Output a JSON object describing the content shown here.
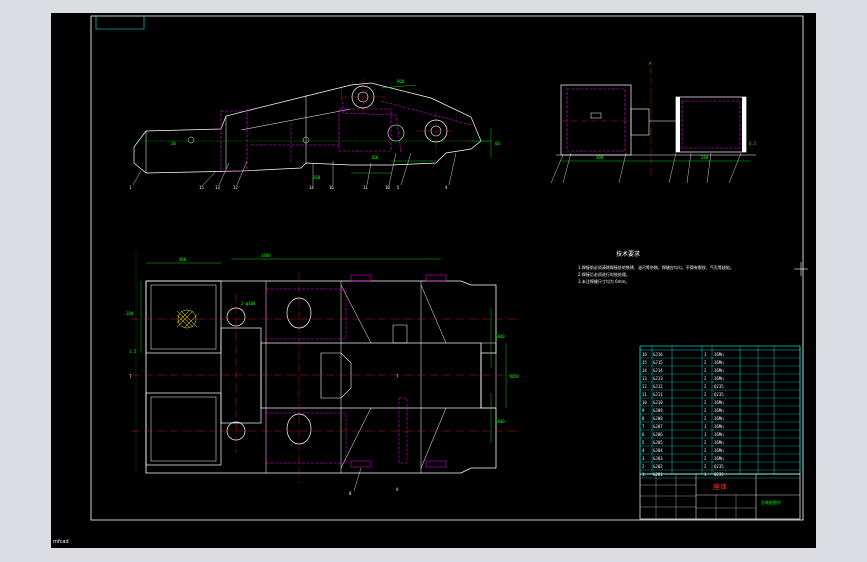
{
  "notes": {
    "title": "技术要求",
    "lines": [
      "1.焊接前必须清除焊接处的铁锈、油污等杂物，焊缝应均匀，不得有裂纹、气孔等缺陷。",
      "2.焊接后必须进行时效处理。",
      "3.未注焊缝尺寸均为 6mm。"
    ]
  },
  "title_block": {
    "name": "座体",
    "subtitle": "总装配图号"
  },
  "bom_rows": [
    {
      "no": "16",
      "code": "GJ16",
      "qty": "1",
      "mat": "16Mn"
    },
    {
      "no": "15",
      "code": "GJ15",
      "qty": "2",
      "mat": "16Mn"
    },
    {
      "no": "14",
      "code": "GJ14",
      "qty": "2",
      "mat": "16Mn"
    },
    {
      "no": "13",
      "code": "GJ13",
      "qty": "2",
      "mat": "16Mn"
    },
    {
      "no": "12",
      "code": "GJ12",
      "qty": "2",
      "mat": "Q235"
    },
    {
      "no": "11",
      "code": "GJ11",
      "qty": "2",
      "mat": "Q235"
    },
    {
      "no": "10",
      "code": "GJ10",
      "qty": "2",
      "mat": "16Mn"
    },
    {
      "no": "9",
      "code": "GJ09",
      "qty": "2",
      "mat": "16Mn"
    },
    {
      "no": "8",
      "code": "GJ08",
      "qty": "2",
      "mat": "16Mn"
    },
    {
      "no": "7",
      "code": "GJ07",
      "qty": "1",
      "mat": "16Mn"
    },
    {
      "no": "6",
      "code": "GJ06",
      "qty": "1",
      "mat": "16Mn"
    },
    {
      "no": "5",
      "code": "GJ05",
      "qty": "2",
      "mat": "16Mn"
    },
    {
      "no": "4",
      "code": "GJ04",
      "qty": "2",
      "mat": "16Mn"
    },
    {
      "no": "3",
      "code": "GJ03",
      "qty": "2",
      "mat": "16Mn"
    },
    {
      "no": "2",
      "code": "GJ02",
      "qty": "2",
      "mat": "Q235"
    },
    {
      "no": "1",
      "code": "GJ01",
      "qty": "1",
      "mat": "Q235"
    }
  ],
  "watermark": "mfcad",
  "colors": {
    "background": "#000000",
    "frame": "#ffffff",
    "outline": "#ffffff",
    "hidden": "#ff00ff",
    "center": "#ff2020",
    "dimension": "#00ff00",
    "table": "#00ffff"
  }
}
